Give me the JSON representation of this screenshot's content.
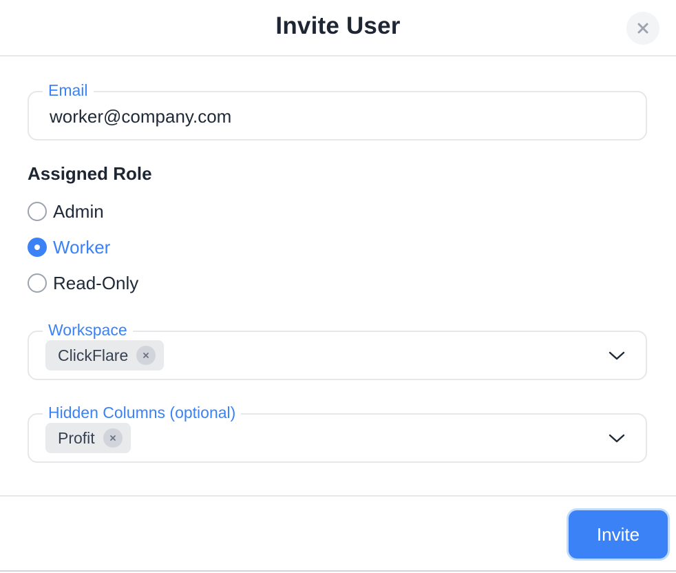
{
  "dialog": {
    "title": "Invite User",
    "close_icon": "close-icon"
  },
  "email": {
    "label": "Email",
    "value": "worker@company.com"
  },
  "role": {
    "heading": "Assigned Role",
    "options": [
      {
        "label": "Admin",
        "checked": false
      },
      {
        "label": "Worker",
        "checked": true
      },
      {
        "label": "Read-Only",
        "checked": false
      }
    ]
  },
  "workspace": {
    "label": "Workspace",
    "chips": [
      "ClickFlare"
    ],
    "dropdown_icon": "chevron-down-icon"
  },
  "hidden_columns": {
    "label": "Hidden Columns (optional)",
    "chips": [
      "Profit"
    ],
    "dropdown_icon": "chevron-down-icon"
  },
  "footer": {
    "invite_label": "Invite"
  },
  "colors": {
    "accent": "#3b82f6",
    "border": "#e5e7eb",
    "chip_bg": "#e9eaec",
    "title": "#1e2533"
  }
}
